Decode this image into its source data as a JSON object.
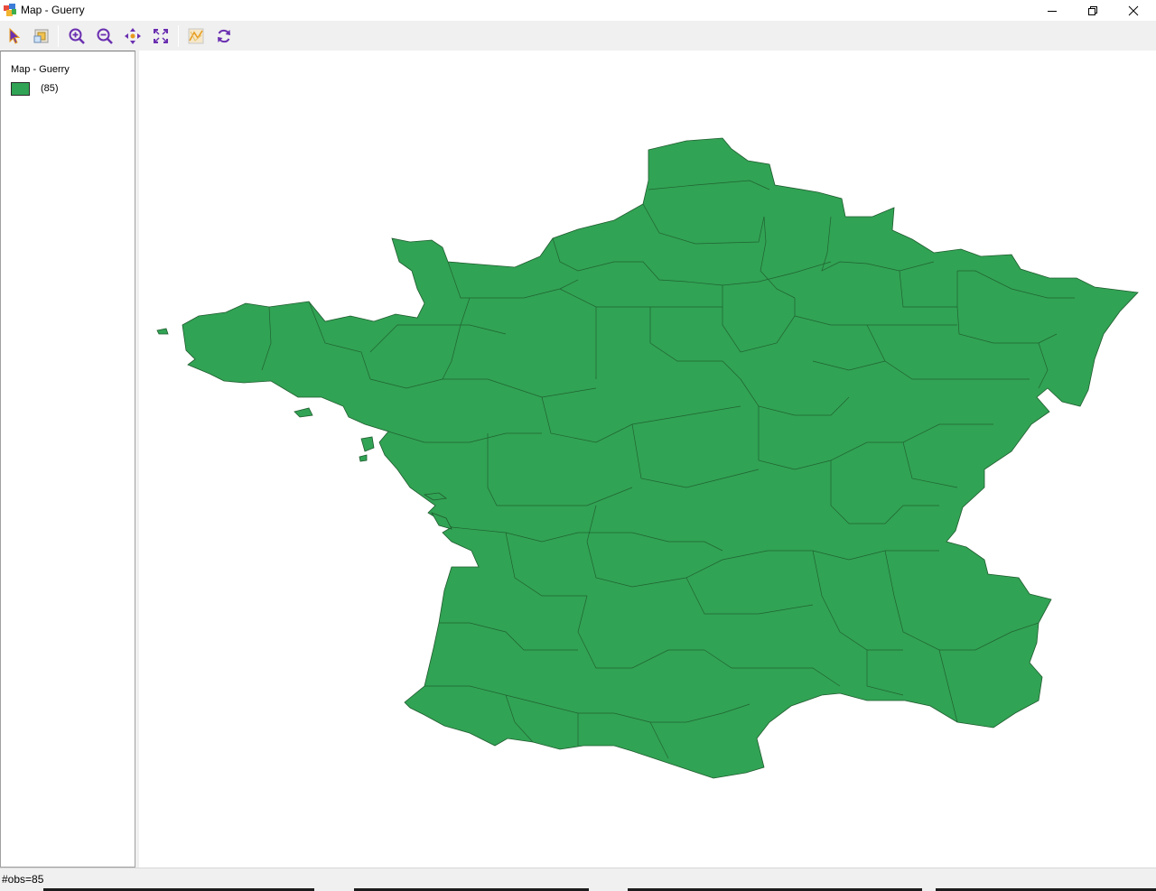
{
  "window": {
    "title": "Map - Guerry"
  },
  "toolbar": {
    "tools": [
      {
        "name": "select-tool",
        "icon": "arrow-pointer-icon"
      },
      {
        "name": "select-layer-tool",
        "icon": "layer-select-icon"
      },
      {
        "name": "zoom-in-tool",
        "icon": "zoom-in-icon"
      },
      {
        "name": "zoom-out-tool",
        "icon": "zoom-out-icon"
      },
      {
        "name": "pan-tool",
        "icon": "pan-arrows-icon"
      },
      {
        "name": "fit-extent-tool",
        "icon": "full-extent-icon"
      },
      {
        "name": "map-options-tool",
        "icon": "map-layers-icon"
      },
      {
        "name": "refresh-tool",
        "icon": "refresh-icon"
      }
    ]
  },
  "legend": {
    "title": "Map - Guerry",
    "category": {
      "label": "(85)",
      "color": "#31a354"
    }
  },
  "map": {
    "fill_color": "#31a354",
    "border_color": "#1e5c2e",
    "region_count": 85
  },
  "status": {
    "text": "#obs=85"
  },
  "colors": {
    "accent_purple": "#6a2fb0",
    "accent_orange": "#e89a1a"
  }
}
